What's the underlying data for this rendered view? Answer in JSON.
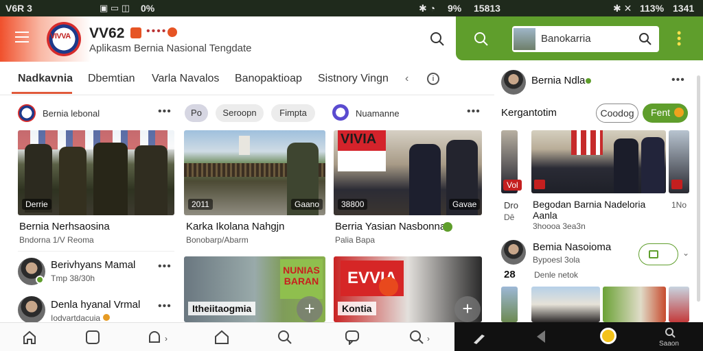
{
  "status": {
    "left": "V6R 3",
    "indicators": "0%",
    "right_pct": "9%",
    "right_time": "15813",
    "right2_pct": "113%",
    "right2_time": "1341"
  },
  "header": {
    "logo_text": "VIVVA",
    "app_name": "VV62",
    "subtitle": "Aplikasm Bernia Nasional Tengdate"
  },
  "green_search": {
    "value": "Banokarria"
  },
  "tabs": [
    "Nadkavnia",
    "Dbemtian",
    "Varla Navalos",
    "Banopaktioap",
    "Sistnory Vingn"
  ],
  "col1": {
    "source": "Bernia lebonal",
    "card": {
      "badge": "Derrie",
      "title": "Bernia Nerhsaosina",
      "meta": "Bndorna 1/V Reoma"
    },
    "list": [
      {
        "title": "Berivhyans Mamal",
        "meta": "Tmp 38/30h"
      },
      {
        "title": "Denla hyanal Vrmal",
        "meta": "Iodvartdacuia"
      }
    ]
  },
  "chips": [
    "Po",
    "Seroopn",
    "Fimpta"
  ],
  "col2": {
    "card": {
      "badge_left": "2011",
      "badge_right": "Gaano",
      "title": "Karka Ikolana Nahgjn",
      "meta": "Bonobarp/Abarm"
    },
    "bottom_title": "Itheiitaogmia"
  },
  "col3": {
    "source": "Nuamanne",
    "card": {
      "badge_left": "38800",
      "badge_right": "Gavae",
      "title": "Berria Yasian Nasbonna",
      "meta": "Palia Bapa"
    },
    "banner_text": "EVVIA",
    "bottom_title": "Kontia"
  },
  "col3_banner2": "VIVIA",
  "col2_banner": "NUNIAS BARAN",
  "right": {
    "profile_name": "Bernia Ndla",
    "section_title": "Kergantotim",
    "btn_outline": "Coodog",
    "btn_green": "Fent",
    "card": {
      "side_left": "Dro",
      "side_left2": "Dê",
      "badge_red": "Vol",
      "title": "Begodan Barnia Nadeloria",
      "title2": "Aanla",
      "meta": "3hoooa 3ea3n",
      "side_right": "1No"
    },
    "item": {
      "num": "28",
      "title": "Bemia Nasoioma",
      "meta": "Bypoesl 3ola",
      "meta2": "Denle netok"
    }
  },
  "bottom_nav_right_label": "Saaon",
  "colors": {
    "accent_orange": "#e0593a",
    "green": "#5f9e2c",
    "dark": "#111111"
  }
}
